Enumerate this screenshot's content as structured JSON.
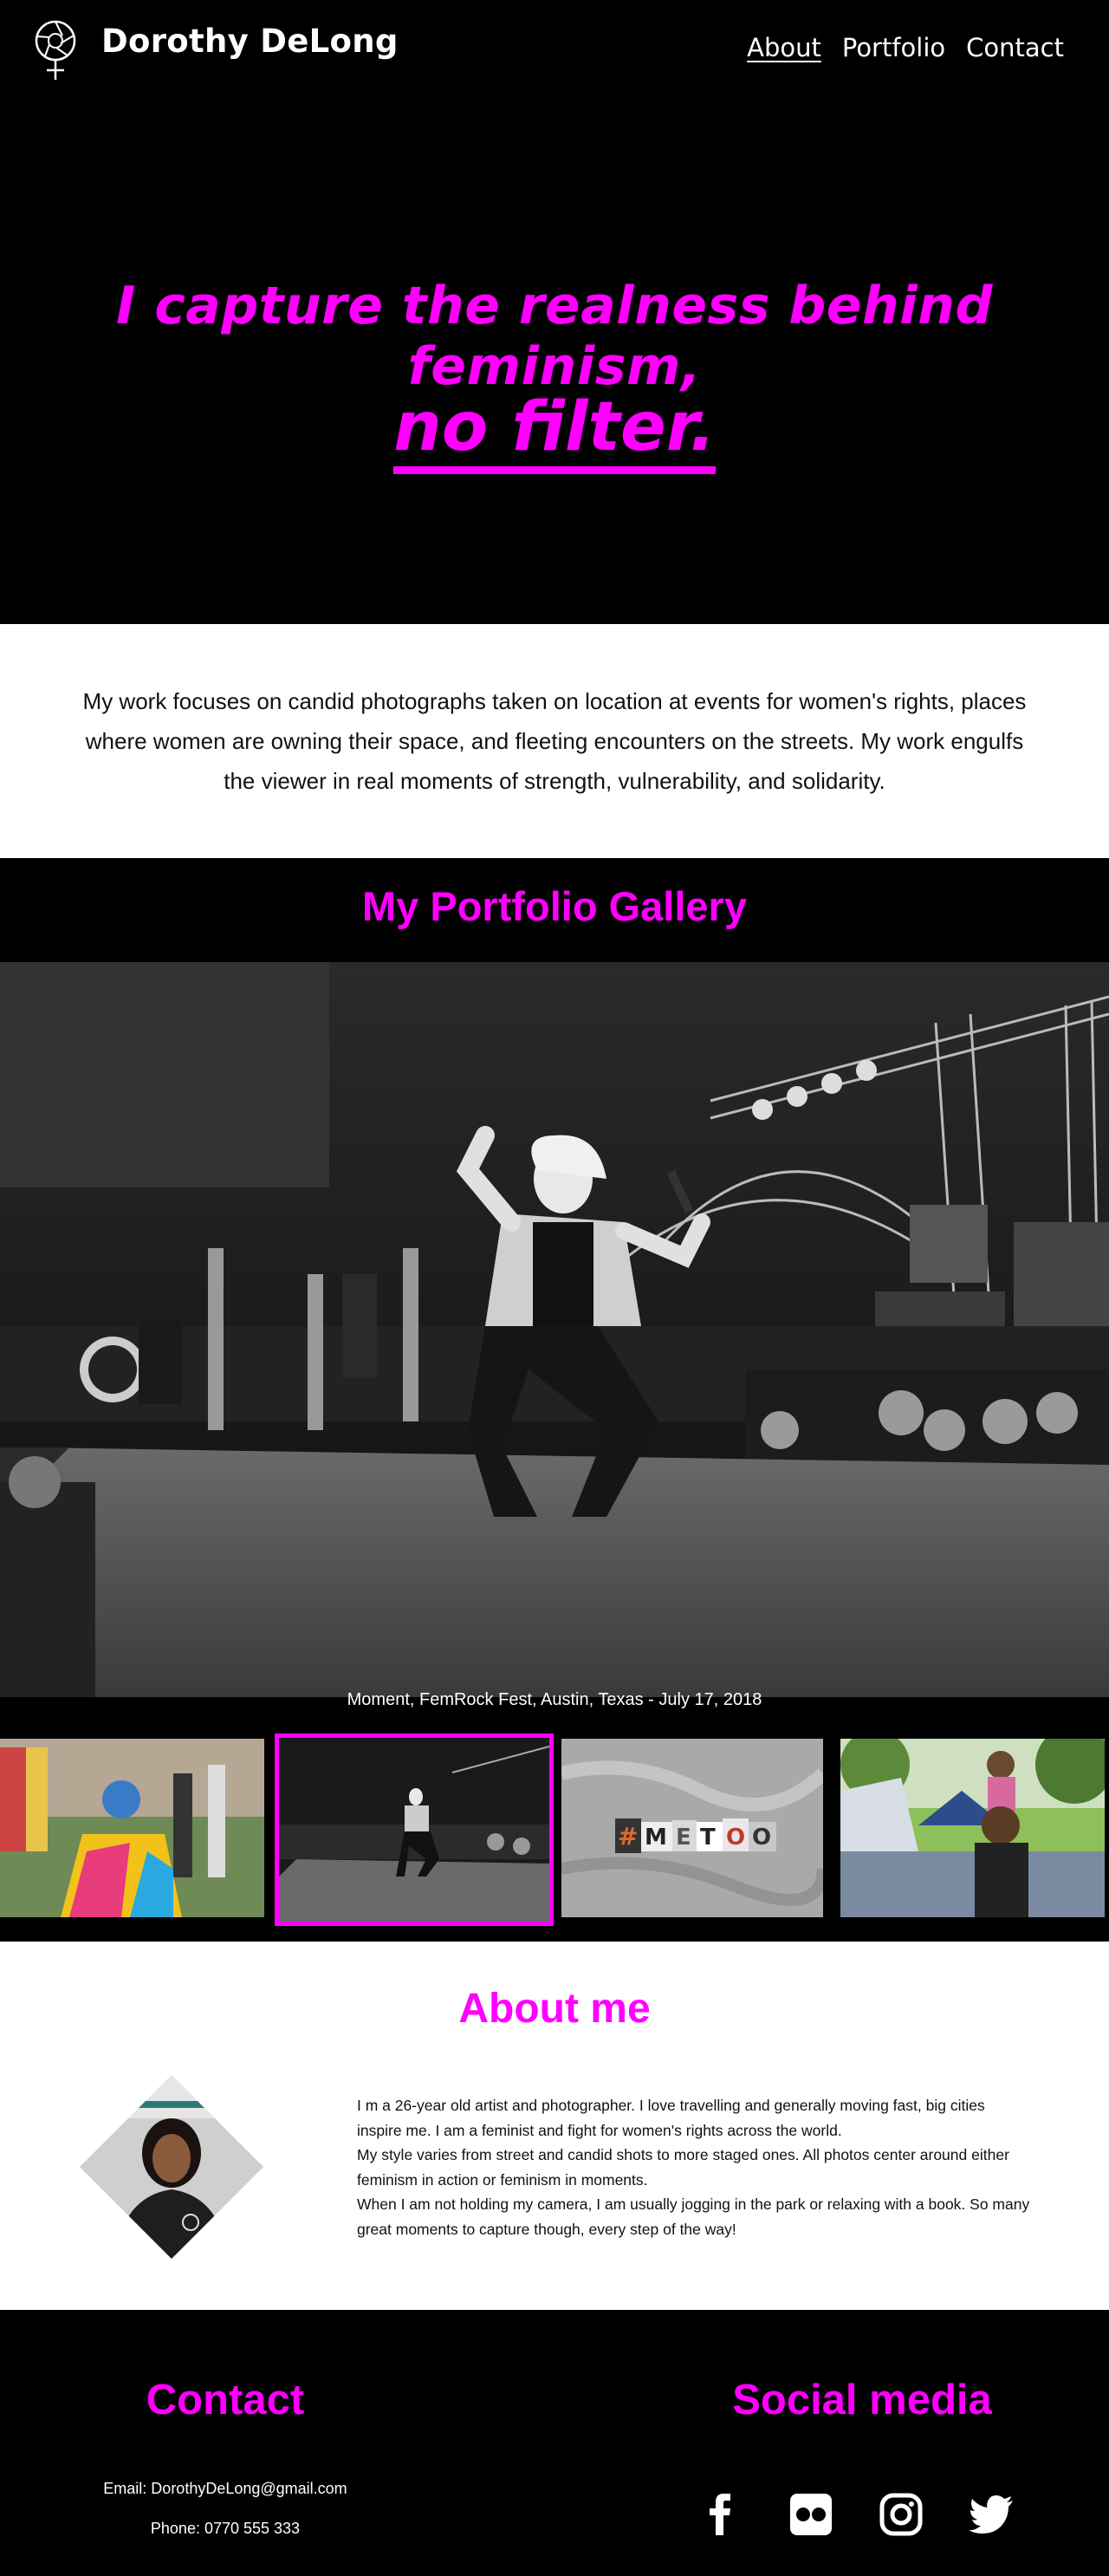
{
  "header": {
    "brand": "Dorothy DeLong",
    "logo_icon": "venus-camera-aperture-icon",
    "nav": [
      {
        "label": "About",
        "active": true
      },
      {
        "label": "Portfolio",
        "active": false
      },
      {
        "label": "Contact",
        "active": false
      }
    ],
    "hero_line1": "I capture the realness behind feminism,",
    "hero_line2": "no filter."
  },
  "intro": {
    "text": "My work focuses on candid photographs taken on location at events for women's rights, places where women are owning their space, and fleeting encounters on the streets. My work engulfs the viewer in real moments of strength, vulnerability, and solidarity."
  },
  "gallery": {
    "title": "My Portfolio Gallery",
    "caption": "Moment, FemRock Fest, Austin, Texas - July 17, 2018",
    "thumbnails": [
      {
        "subject": "pride-flag-crowd",
        "selected": false
      },
      {
        "subject": "stage-performer",
        "selected": true
      },
      {
        "subject": "metoo-letters",
        "selected": false,
        "text": "#METOO"
      },
      {
        "subject": "father-daughter-festival",
        "selected": false
      }
    ]
  },
  "about": {
    "title": "About me",
    "paragraphs": [
      "I m a 26-year old artist and photographer. I love travelling and generally moving fast, big cities inspire me. I am a feminist and fight for women's rights across the world.",
      "My style varies from street and candid shots to more staged ones. All photos center around either feminism in action or feminism in moments.",
      "When I am not holding my camera, I am usually jogging in the park or relaxing with a book. So many great moments to capture though, every step of the way!"
    ]
  },
  "footer": {
    "contact_title": "Contact",
    "email": "Email: DorothyDeLong@gmail.com",
    "phone": "Phone: 0770 555 333",
    "social_title": "Social media",
    "social_icons": [
      "facebook-icon",
      "flickr-icon",
      "instagram-icon",
      "twitter-icon"
    ]
  },
  "colors": {
    "accent": "#ff00ff",
    "background": "#000000",
    "light_section": "#ffffff"
  }
}
